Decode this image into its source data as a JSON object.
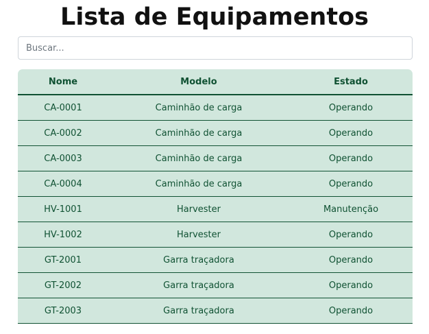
{
  "page": {
    "title": "Lista de Equipamentos"
  },
  "search": {
    "placeholder": "Buscar..."
  },
  "table": {
    "headers": {
      "name": "Nome",
      "model": "Modelo",
      "status": "Estado"
    },
    "rows": [
      {
        "name": "CA-0001",
        "model": "Caminhão de carga",
        "status": "Operando"
      },
      {
        "name": "CA-0002",
        "model": "Caminhão de carga",
        "status": "Operando"
      },
      {
        "name": "CA-0003",
        "model": "Caminhão de carga",
        "status": "Operando"
      },
      {
        "name": "CA-0004",
        "model": "Caminhão de carga",
        "status": "Operando"
      },
      {
        "name": "HV-1001",
        "model": "Harvester",
        "status": "Manutenção"
      },
      {
        "name": "HV-1002",
        "model": "Harvester",
        "status": "Operando"
      },
      {
        "name": "GT-2001",
        "model": "Garra traçadora",
        "status": "Operando"
      },
      {
        "name": "GT-2002",
        "model": "Garra traçadora",
        "status": "Operando"
      },
      {
        "name": "GT-2003",
        "model": "Garra traçadora",
        "status": "Operando"
      }
    ]
  },
  "colors": {
    "table_bg": "#d1e7dd",
    "table_text": "#0f5132",
    "border": "#0f5132"
  }
}
